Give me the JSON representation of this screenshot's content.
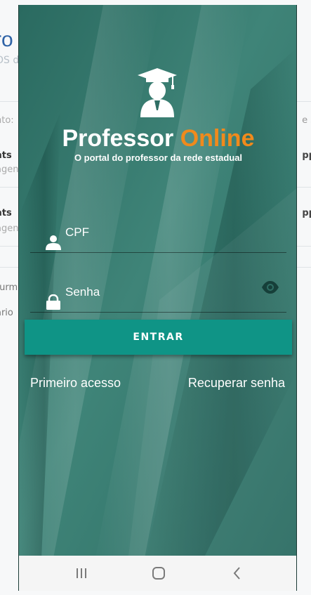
{
  "background_page": {
    "title_fragment": "ro",
    "subtitle_fragment": "OS d",
    "row_label": "nto:",
    "right_fragment": "e s",
    "rows": [
      {
        "title": "ats",
        "sub": "agen",
        "right": "pp"
      },
      {
        "title": "ats",
        "sub": "agen",
        "right": "pp"
      }
    ],
    "footer1": "turm",
    "footer2": "ário"
  },
  "app": {
    "brand_white": "Professor",
    "brand_orange": "Online",
    "tagline": "O portal do professor da rede estadual",
    "cpf_placeholder": "CPF",
    "password_placeholder": "Senha",
    "enter_button": "ENTRAR",
    "first_access_link": "Primeiro acesso",
    "recover_password_link": "Recuperar senha",
    "icons": {
      "logo": "graduate-teacher-icon",
      "cpf": "user-icon",
      "password": "lock-icon",
      "toggle_visibility": "eye-icon"
    },
    "colors": {
      "background": "#2f6e64",
      "accent_orange": "#f08a1c",
      "button": "#0f9486"
    }
  },
  "navigation_bar": {
    "recents": "recents-icon",
    "home": "home-icon",
    "back": "back-icon"
  }
}
